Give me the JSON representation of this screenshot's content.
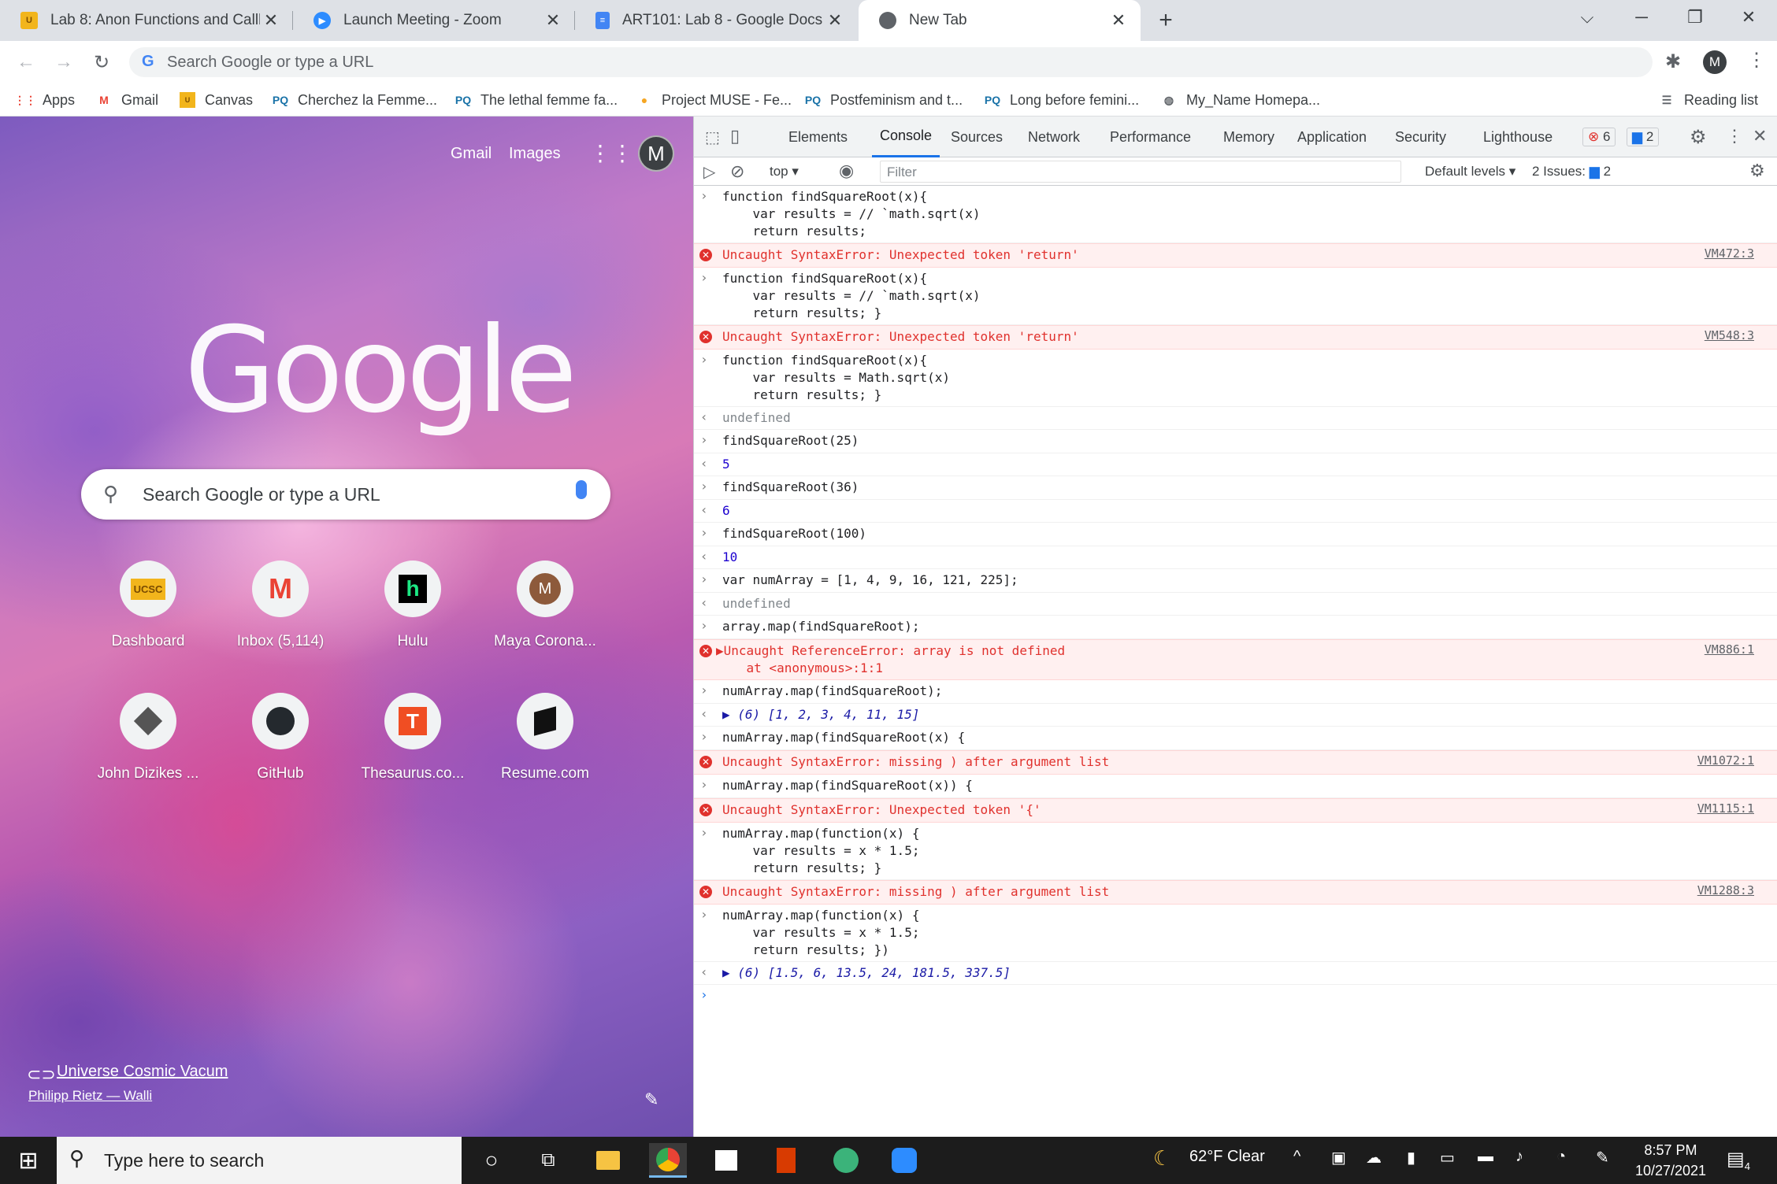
{
  "tabs": [
    {
      "title": "Lab 8: Anon Functions and Callbacks",
      "icon": "ucsc-favicon"
    },
    {
      "title": "Launch Meeting - Zoom",
      "icon": "zoom-favicon"
    },
    {
      "title": "ART101: Lab 8 - Google Docs",
      "icon": "google-docs-favicon"
    },
    {
      "title": "New Tab",
      "icon": "chrome-favicon"
    }
  ],
  "omnibox": {
    "placeholder": "Search Google or type a URL"
  },
  "profile_initial": "M",
  "bookmarks": [
    {
      "label": "Apps",
      "icon": "apps-grid-icon"
    },
    {
      "label": "Gmail",
      "icon": "gmail-icon"
    },
    {
      "label": "Canvas",
      "icon": "ucsc-icon"
    },
    {
      "label": "Cherchez la Femme...",
      "icon": "pq-icon"
    },
    {
      "label": "The lethal femme fa...",
      "icon": "pq-icon"
    },
    {
      "label": "Project MUSE - Fe...",
      "icon": "muse-icon"
    },
    {
      "label": "Postfeminism and t...",
      "icon": "pq-icon"
    },
    {
      "label": "Long before femini...",
      "icon": "pq-icon"
    },
    {
      "label": "My_Name Homepa...",
      "icon": "globe-icon"
    }
  ],
  "reading_list": "Reading list",
  "ntp": {
    "gmail": "Gmail",
    "images": "Images",
    "avatar": "M",
    "logo": "Google",
    "search_placeholder": "Search Google or type a URL",
    "shortcuts": [
      {
        "label": "Dashboard"
      },
      {
        "label": "Inbox (5,114)"
      },
      {
        "label": "Hulu"
      },
      {
        "label": "Maya Corona..."
      },
      {
        "label": "John Dizikes ..."
      },
      {
        "label": "GitHub"
      },
      {
        "label": "Thesaurus.co..."
      },
      {
        "label": "Resume.com"
      }
    ],
    "bg_title": "Universe Cosmic Vacum",
    "bg_author": "Philipp Rietz — Walli"
  },
  "devtools": {
    "tabs": [
      "Elements",
      "Console",
      "Sources",
      "Network",
      "Performance",
      "Memory",
      "Application",
      "Security",
      "Lighthouse"
    ],
    "error_count": "6",
    "issue_count": "2",
    "context": "top",
    "filter_placeholder": "Filter",
    "levels": "Default levels",
    "issues_label": "2 Issues:",
    "issues_badge": "2"
  },
  "console": [
    {
      "type": "input",
      "text": "function findSquareRoot(x){\n    var results = // `math.sqrt(x)\n    return results;"
    },
    {
      "type": "error",
      "text": "Uncaught SyntaxError: Unexpected token 'return'",
      "src": "VM472:3"
    },
    {
      "type": "input",
      "text": "function findSquareRoot(x){\n    var results = // `math.sqrt(x)\n    return results; }"
    },
    {
      "type": "error",
      "text": "Uncaught SyntaxError: Unexpected token 'return'",
      "src": "VM548:3"
    },
    {
      "type": "input",
      "text": "function findSquareRoot(x){\n    var results = Math.sqrt(x)\n    return results; }"
    },
    {
      "type": "output",
      "text": "undefined"
    },
    {
      "type": "input",
      "text": "findSquareRoot(25)"
    },
    {
      "type": "output",
      "text": "5"
    },
    {
      "type": "input",
      "text": "findSquareRoot(36)"
    },
    {
      "type": "output",
      "text": "6"
    },
    {
      "type": "input",
      "text": "findSquareRoot(100)"
    },
    {
      "type": "output",
      "text": "10"
    },
    {
      "type": "input",
      "text": "var numArray = [1, 4, 9, 16, 121, 225];"
    },
    {
      "type": "output",
      "text": "undefined"
    },
    {
      "type": "input",
      "text": "array.map(findSquareRoot);"
    },
    {
      "type": "error",
      "text": "▶Uncaught ReferenceError: array is not defined\n    at <anonymous>:1:1",
      "src": "VM886:1"
    },
    {
      "type": "input",
      "text": "numArray.map(findSquareRoot);"
    },
    {
      "type": "output",
      "text": "▶ (6) [1, 2, 3, 4, 11, 15]"
    },
    {
      "type": "input",
      "text": "numArray.map(findSquareRoot(x) {"
    },
    {
      "type": "error",
      "text": "Uncaught SyntaxError: missing ) after argument list",
      "src": "VM1072:1"
    },
    {
      "type": "input",
      "text": "numArray.map(findSquareRoot(x)) {"
    },
    {
      "type": "error",
      "text": "Uncaught SyntaxError: Unexpected token '{'",
      "src": "VM1115:1"
    },
    {
      "type": "input",
      "text": "numArray.map(function(x) {\n    var results = x * 1.5;\n    return results; }"
    },
    {
      "type": "error",
      "text": "Uncaught SyntaxError: missing ) after argument list",
      "src": "VM1288:3"
    },
    {
      "type": "input",
      "text": "numArray.map(function(x) {\n    var results = x * 1.5;\n    return results; })"
    },
    {
      "type": "output",
      "text": "▶ (6) [1.5, 6, 13.5, 24, 181.5, 337.5]"
    }
  ],
  "taskbar": {
    "search_placeholder": "Type here to search",
    "weather": "62°F  Clear",
    "time": "8:57 PM",
    "date": "10/27/2021",
    "notifications": "4"
  }
}
